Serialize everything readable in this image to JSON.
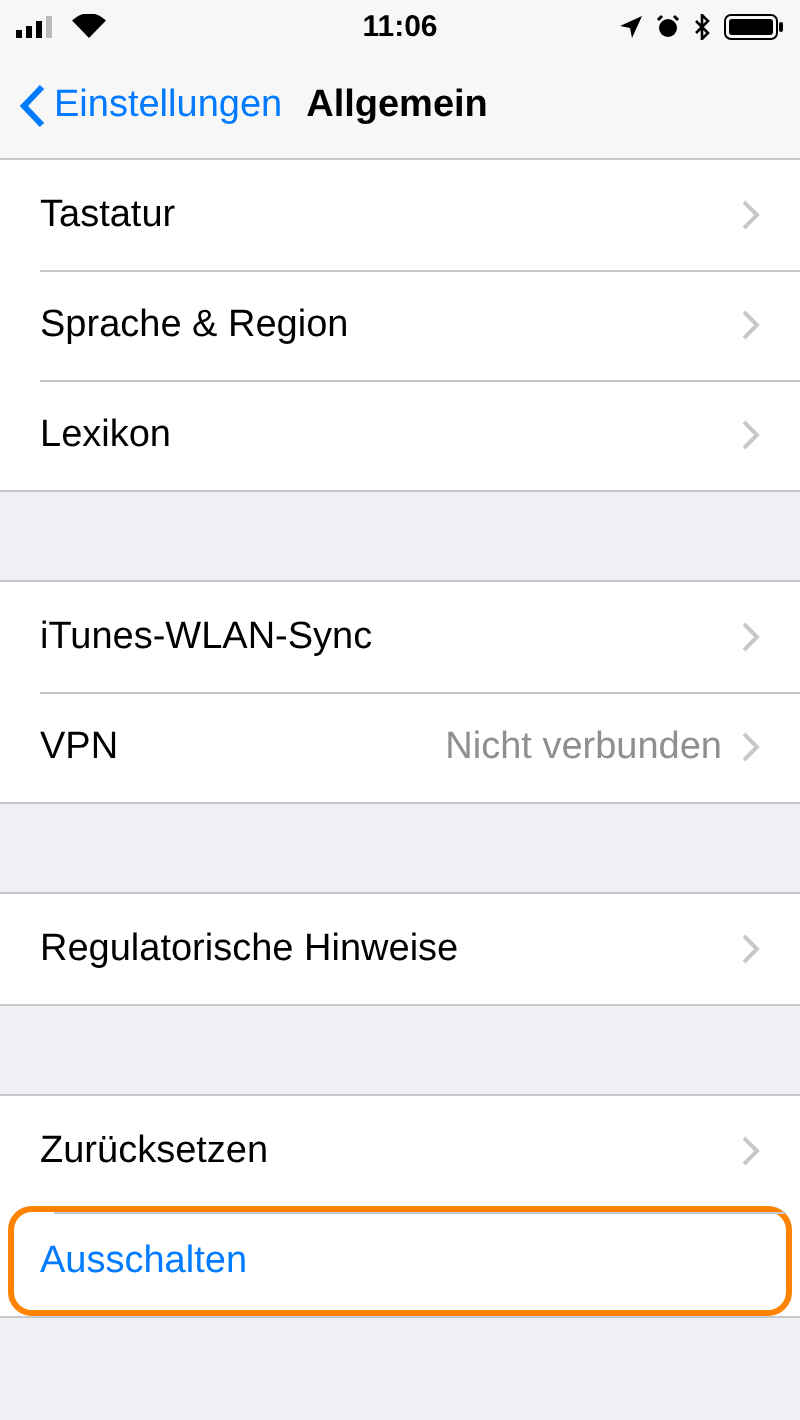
{
  "status_bar": {
    "time": "11:06"
  },
  "nav": {
    "back": "Einstellungen",
    "title": "Allgemein"
  },
  "groups": [
    {
      "rows": [
        {
          "kind": "link",
          "label": "Tastatur",
          "highlighted": false
        },
        {
          "kind": "link",
          "label": "Sprache & Region",
          "highlighted": false
        },
        {
          "kind": "link",
          "label": "Lexikon",
          "highlighted": false
        }
      ]
    },
    {
      "rows": [
        {
          "kind": "link",
          "label": "iTunes-WLAN-Sync",
          "highlighted": false
        },
        {
          "kind": "link",
          "label": "VPN",
          "value": "Nicht verbunden",
          "highlighted": false
        }
      ]
    },
    {
      "rows": [
        {
          "kind": "link",
          "label": "Regulatorische Hinweise",
          "highlighted": false
        }
      ]
    },
    {
      "rows": [
        {
          "kind": "link",
          "label": "Zurücksetzen",
          "highlighted": false
        },
        {
          "kind": "action",
          "label": "Ausschalten",
          "highlighted": true
        }
      ]
    }
  ]
}
